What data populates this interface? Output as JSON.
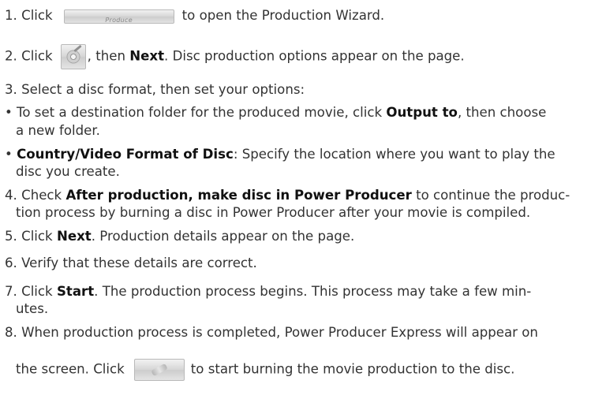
{
  "steps": {
    "s1": {
      "num": "1. Click",
      "produce_caption": "Produce",
      "rest": "to open the Production Wizard."
    },
    "s2": {
      "num": "2. Click",
      "mid": ", then",
      "next": "Next",
      "rest": ". Disc production options appear on the page."
    },
    "s3": {
      "text": "3. Select a disc format, then set your options:"
    },
    "b1": {
      "pre": "• To set a destination folder for the produced movie, click",
      "bold": "Output to",
      "post": ", then choose",
      "line2": "a new folder."
    },
    "b2": {
      "bullet": "• ",
      "bold": "Country/Video Format of Disc",
      "post": ": Specify the location where you want to play the",
      "line2": "disc you create."
    },
    "s4": {
      "pre": "4. Check",
      "bold": "After production, make disc in Power Producer",
      "post": "to continue the produc-",
      "line2": "tion process by burning a disc in Power Producer after your movie is compiled."
    },
    "s5": {
      "pre": "5. Click",
      "bold": "Next",
      "post": ". Production details appear on the page."
    },
    "s6": {
      "text": "6. Verify that these details are correct."
    },
    "s7": {
      "pre": "7. Click",
      "bold": "Start",
      "post": ". The production process begins. This process may take a few min-",
      "line2": "utes."
    },
    "s8": {
      "line1": "8. When production process is completed, Power Producer Express will appear on",
      "pre": "the screen. Click",
      "post": "to start burning the movie production to the disc."
    }
  },
  "icons": {
    "produce_button": "produce-button-icon",
    "disc_wizard": "disc-production-icon",
    "burn_button": "burn-disc-icon"
  }
}
